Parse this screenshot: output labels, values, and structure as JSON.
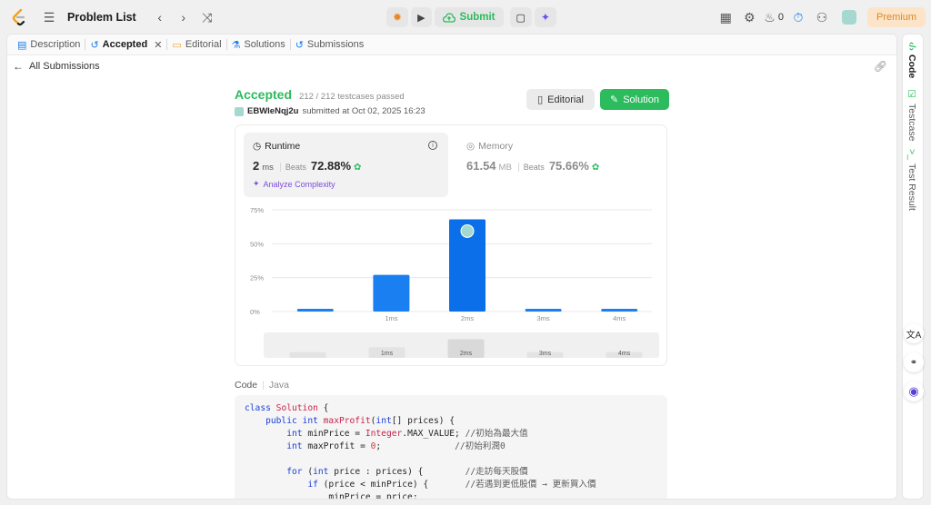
{
  "topbar": {
    "problem_list": "Problem List",
    "submit": "Submit",
    "streak_count": "0",
    "premium": "Premium"
  },
  "tabs": [
    {
      "label": "Description",
      "icon": "document-icon"
    },
    {
      "label": "Accepted",
      "icon": "history-icon",
      "active": true
    },
    {
      "label": "Editorial",
      "icon": "book-icon"
    },
    {
      "label": "Solutions",
      "icon": "flask-icon"
    },
    {
      "label": "Submissions",
      "icon": "history-icon"
    }
  ],
  "subheader": {
    "back_label": "All Submissions"
  },
  "result": {
    "status": "Accepted",
    "testcases": "212 / 212 testcases passed",
    "username": "EBWIeNqj2u",
    "submitted_text": "submitted at Oct 02, 2025 16:23",
    "editorial_btn": "Editorial",
    "solution_btn": "Solution"
  },
  "runtime": {
    "title": "Runtime",
    "value": "2",
    "unit": "ms",
    "beats_label": "Beats",
    "beats_pct": "72.88%",
    "analyze": "Analyze Complexity"
  },
  "memory": {
    "title": "Memory",
    "value": "61.54",
    "unit": "MB",
    "beats_label": "Beats",
    "beats_pct": "75.66%"
  },
  "chart_data": {
    "type": "bar",
    "categories": [
      "",
      "1ms",
      "2ms",
      "3ms",
      "4ms"
    ],
    "values": [
      2,
      27,
      68,
      2,
      2
    ],
    "highlight_index": 2,
    "ytick_labels": [
      "0%",
      "25%",
      "50%",
      "75%"
    ],
    "yticks": [
      0,
      25,
      50,
      75
    ],
    "ylim": [
      0,
      75
    ],
    "grid": true
  },
  "scroller_labels": [
    "",
    "1ms",
    "2ms",
    "3ms",
    "4ms"
  ],
  "code": {
    "label": "Code",
    "language": "Java"
  },
  "colors": {
    "accent_green": "#2cbb5d",
    "bar_blue": "#1a7ff0",
    "bar_highlight": "#0a6fe8"
  },
  "rightbar": {
    "code": "Code",
    "testcase": "Testcase",
    "test_result": "Test Result"
  }
}
